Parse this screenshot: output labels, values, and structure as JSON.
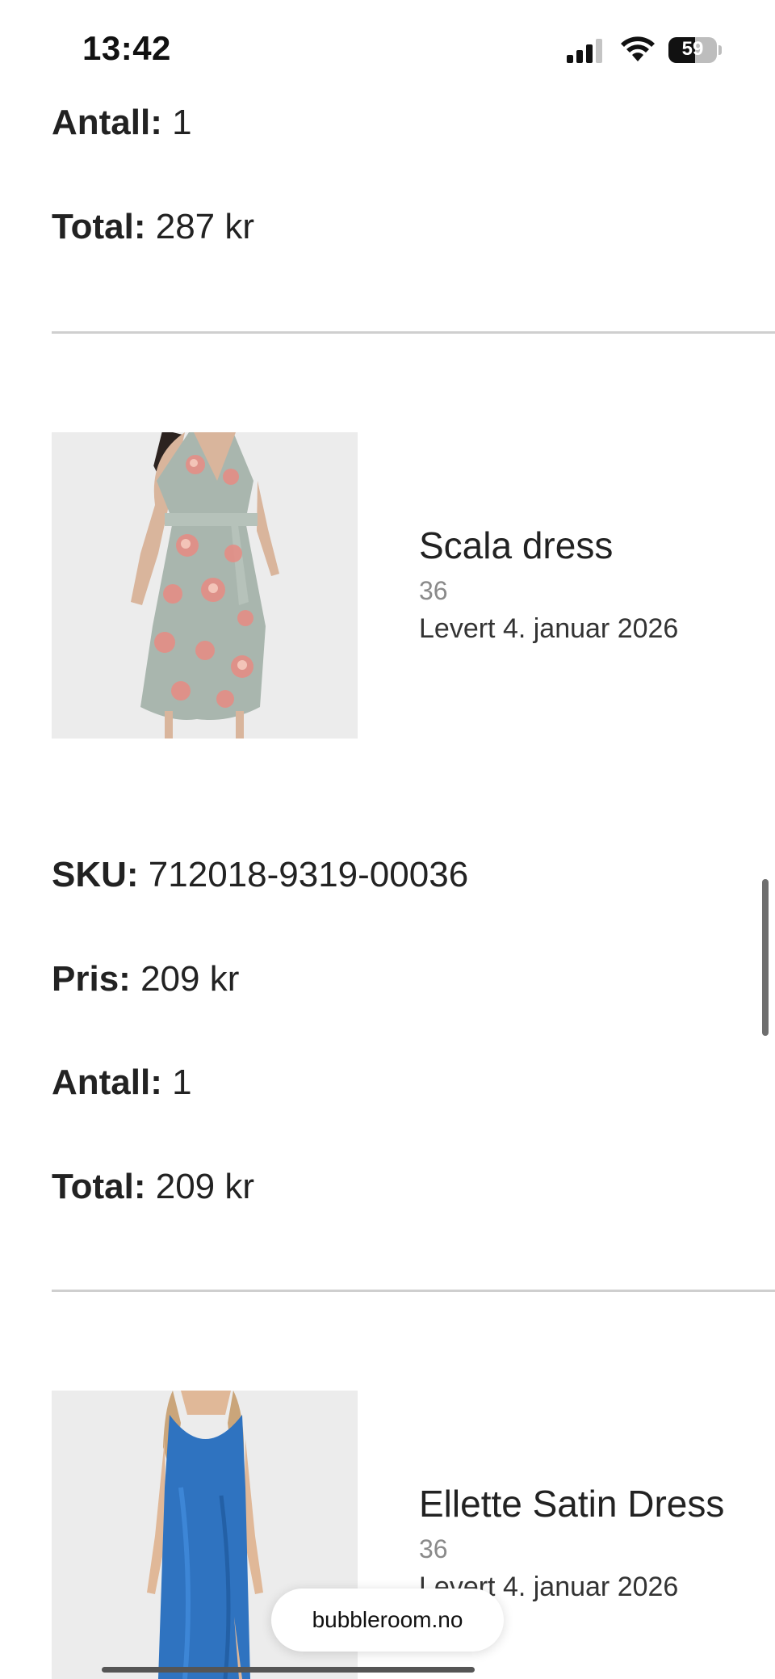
{
  "status": {
    "time": "13:42",
    "battery": "59"
  },
  "order_items": [
    {
      "antall_label": "Antall:",
      "antall": "1",
      "total_label": "Total:",
      "total": "287 kr"
    },
    {
      "name": "Scala dress",
      "size": "36",
      "delivery": "Levert 4. januar 2026",
      "sku_label": "SKU:",
      "sku": "712018-9319-00036",
      "pris_label": "Pris:",
      "pris": "209 kr",
      "antall_label": "Antall:",
      "antall": "1",
      "total_label": "Total:",
      "total": "209 kr"
    },
    {
      "name": "Ellette Satin Dress",
      "size": "36",
      "delivery": "Levert 4. januar 2026"
    }
  ],
  "browser": {
    "url": "bubbleroom.no"
  },
  "colors": {
    "dress_floral_bg": "#a9b6ae",
    "dress_blue": "#2f73c0",
    "divider": "#cfcfcf"
  }
}
